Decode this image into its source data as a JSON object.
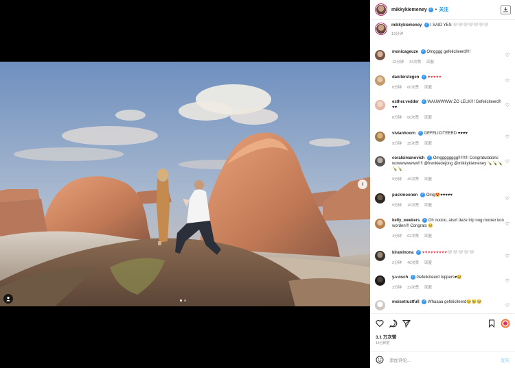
{
  "post": {
    "username": "mikkykiemeney",
    "verified_mark": "✓",
    "header_separator": "•",
    "follow_label": "关注",
    "caption_text": "I SAID YES 🤍🤍🤍🤍🤍🤍🤍",
    "caption_time": "13分钟",
    "likes_label": "3.1 万次赞",
    "time_ago": "13分钟前",
    "add_comment_placeholder": "添加评论...",
    "post_label": "发布"
  },
  "comments": [
    {
      "username": "monicageuze",
      "text": "Omgggg gefeliciteerd!!!!",
      "time": "12分钟",
      "likes": "34次赞",
      "reply": "回复"
    },
    {
      "username": "daniterstegen",
      "text": "♥♥♥♥♥",
      "red": true,
      "time": "8分钟",
      "likes": "60次赞",
      "reply": "回复"
    },
    {
      "username": "esther.vedder",
      "text": "WAUWWWW ZO LEUK!!! Gefeliciteerd!! ♥♥",
      "time": "8分钟",
      "likes": "60次赞",
      "reply": "回复"
    },
    {
      "username": "vivianhoorn",
      "text": "GEFELICITEERD ♥♥♥♥",
      "time": "9分钟",
      "likes": "35次赞",
      "reply": "回复"
    },
    {
      "username": "coralsimanovich",
      "text": "Omgggggggg!!!!!!!!! Congratulations wowwwwwww!!!! @frenkiedejong @mikkykiemeney 🍾🍾🍾🍾🍾",
      "time": "9分钟",
      "likes": "49次赞",
      "reply": "回复"
    },
    {
      "username": "puckmoonen",
      "text": "Omg😍♥♥♥♥♥",
      "time": "9分钟",
      "likes": "16次赞",
      "reply": "回复"
    },
    {
      "username": "kelly_weekers",
      "text": "Oh noooo, alsof deze trip nog mooier kon worden!!! Congrats 🥹",
      "time": "4分钟",
      "likes": "62次赞",
      "reply": "回复"
    },
    {
      "username": "kirawinona",
      "text": "♥♥♥♥♥♥♥♥♥🤍🤍🤍🤍🤍",
      "time": "2分钟",
      "likes": "46次赞",
      "reply": "回复"
    },
    {
      "username": "y.v.osch",
      "text": "Gefeliciteerd toppers♥🥹",
      "time": "3分钟",
      "likes": "32次赞",
      "reply": "回复"
    },
    {
      "username": "moisetrustfull",
      "text": "Whaaaa gefeliciteerd🥹🥹🥹",
      "time": "",
      "likes": "",
      "reply": ""
    }
  ],
  "icons": {
    "heart": "heart-icon",
    "comment": "comment-icon",
    "share": "share-icon",
    "save": "bookmark-icon",
    "emoji": "emoji-icon"
  },
  "colors": {
    "link_blue": "#0095f6",
    "heart_red": "#ed4956",
    "border": "#efefef"
  }
}
